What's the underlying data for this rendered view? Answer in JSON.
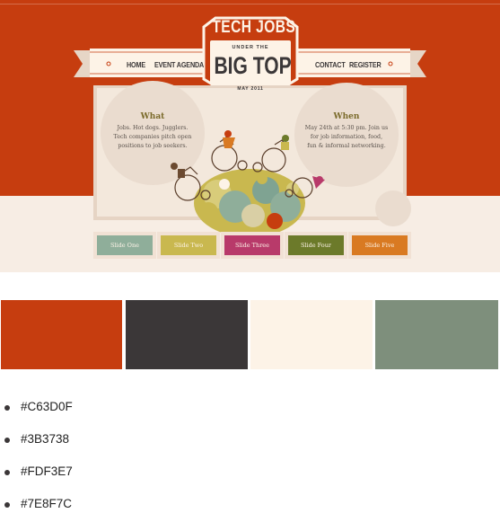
{
  "colors": {
    "brand_orange": "#C63D0F",
    "charcoal": "#3B3738",
    "cream": "#FDF3E7",
    "sage": "#7E8F7C"
  },
  "mockup": {
    "logo": {
      "tech_jobs": "TECH JOBS",
      "under_the": "UNDER THE",
      "big_top": "BIG TOP",
      "date": "MAY 2011"
    },
    "nav": {
      "home": "HOME",
      "event_agenda": "EVENT AGENDA",
      "contact": "CONTACT",
      "register": "REGISTER"
    },
    "what": {
      "title": "What",
      "lines": [
        "Jobs. Hot dogs. Jugglers.",
        "Tech companies pitch open",
        "positions to job seekers."
      ]
    },
    "when": {
      "title": "When",
      "lines": [
        "May 24th at 5:30 pm. Join us",
        "for job information, food,",
        "fun & informal networking."
      ]
    },
    "slides": [
      {
        "label": "Slide One",
        "color": "#8fae9a"
      },
      {
        "label": "Slide Two",
        "color": "#c9b84f"
      },
      {
        "label": "Slide Three",
        "color": "#b83a6a"
      },
      {
        "label": "Slide Four",
        "color": "#6c7a2a"
      },
      {
        "label": "Slide Five",
        "color": "#d97a22"
      }
    ]
  },
  "swatches": [
    {
      "hex": "#C63D0F"
    },
    {
      "hex": "#3B3738"
    },
    {
      "hex": "#FDF3E7"
    },
    {
      "hex": "#7E8F7C"
    }
  ],
  "hex_list": [
    "#C63D0F",
    "#3B3738",
    "#FDF3E7",
    "#7E8F7C"
  ]
}
